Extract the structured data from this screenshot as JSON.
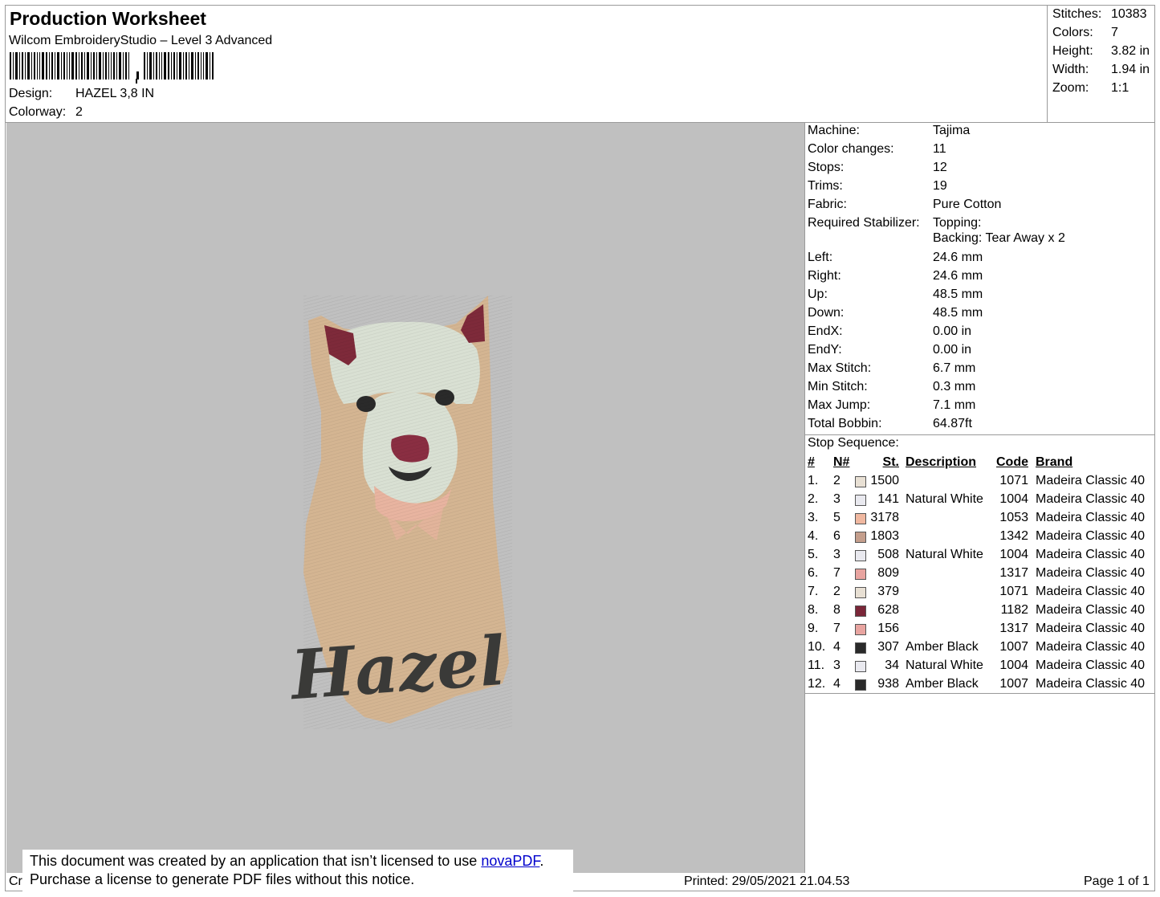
{
  "header": {
    "title": "Production Worksheet",
    "subtitle": "Wilcom EmbroideryStudio – Level 3 Advanced",
    "design_label": "Design:",
    "design_value": "HAZEL 3,8 IN",
    "colorway_label": "Colorway:",
    "colorway_value": "2"
  },
  "stats": [
    {
      "label": "Stitches:",
      "value": "10383"
    },
    {
      "label": "Colors:",
      "value": "7"
    },
    {
      "label": "Height:",
      "value": "3.82 in"
    },
    {
      "label": "Width:",
      "value": "1.94 in"
    },
    {
      "label": "Zoom:",
      "value": "1:1"
    }
  ],
  "design_preview": {
    "text": "Hazel",
    "background": "#c0c0c0",
    "fur_color": "#d4b592",
    "face_color": "#d9e0d3",
    "ear_color": "#7e2a3a",
    "nose_color": "#8a2e42",
    "chin_color": "#e8b4a0",
    "text_color": "#3a3a38"
  },
  "properties": [
    {
      "label": "Machine:",
      "value": "Tajima"
    },
    {
      "label": "Color changes:",
      "value": "11"
    },
    {
      "label": "Stops:",
      "value": "12"
    },
    {
      "label": "Trims:",
      "value": "19"
    },
    {
      "label": "Fabric:",
      "value": "Pure Cotton"
    },
    {
      "label": "Required Stabilizer:",
      "value": "Topping:",
      "value2": "Backing: Tear Away x 2"
    },
    {
      "label": "Left:",
      "value": "24.6 mm"
    },
    {
      "label": "Right:",
      "value": "24.6 mm"
    },
    {
      "label": "Up:",
      "value": "48.5 mm"
    },
    {
      "label": "Down:",
      "value": "48.5 mm"
    },
    {
      "label": "EndX:",
      "value": "0.00 in"
    },
    {
      "label": "EndY:",
      "value": "0.00 in"
    },
    {
      "label": "Max Stitch:",
      "value": "6.7 mm"
    },
    {
      "label": "Min Stitch:",
      "value": "0.3 mm"
    },
    {
      "label": "Max Jump:",
      "value": "7.1 mm"
    },
    {
      "label": "Total Bobbin:",
      "value": "64.87ft"
    }
  ],
  "stop_sequence": {
    "title": "Stop Sequence:",
    "headers": {
      "idx": "#",
      "needle": "N#",
      "stitches": "St.",
      "description": "Description",
      "code": "Code",
      "brand": "Brand"
    },
    "rows": [
      {
        "idx": "1.",
        "needle": "2",
        "color": "#e8e0d4",
        "stitches": "1500",
        "description": "",
        "code": "1071",
        "brand": "Madeira Classic 40"
      },
      {
        "idx": "2.",
        "needle": "3",
        "color": "#e9e9ef",
        "stitches": "141",
        "description": "Natural White",
        "code": "1004",
        "brand": "Madeira Classic 40"
      },
      {
        "idx": "3.",
        "needle": "5",
        "color": "#f0b8a0",
        "stitches": "3178",
        "description": "",
        "code": "1053",
        "brand": "Madeira Classic 40"
      },
      {
        "idx": "4.",
        "needle": "6",
        "color": "#c49e8c",
        "stitches": "1803",
        "description": "",
        "code": "1342",
        "brand": "Madeira Classic 40"
      },
      {
        "idx": "5.",
        "needle": "3",
        "color": "#e9e9ef",
        "stitches": "508",
        "description": "Natural White",
        "code": "1004",
        "brand": "Madeira Classic 40"
      },
      {
        "idx": "6.",
        "needle": "7",
        "color": "#e8a4a0",
        "stitches": "809",
        "description": "",
        "code": "1317",
        "brand": "Madeira Classic 40"
      },
      {
        "idx": "7.",
        "needle": "2",
        "color": "#e8e0d4",
        "stitches": "379",
        "description": "",
        "code": "1071",
        "brand": "Madeira Classic 40"
      },
      {
        "idx": "8.",
        "needle": "8",
        "color": "#7a2638",
        "stitches": "628",
        "description": "",
        "code": "1182",
        "brand": "Madeira Classic 40"
      },
      {
        "idx": "9.",
        "needle": "7",
        "color": "#e8a4a0",
        "stitches": "156",
        "description": "",
        "code": "1317",
        "brand": "Madeira Classic 40"
      },
      {
        "idx": "10.",
        "needle": "4",
        "color": "#2a2a2a",
        "stitches": "307",
        "description": "Amber Black",
        "code": "1007",
        "brand": "Madeira Classic 40"
      },
      {
        "idx": "11.",
        "needle": "3",
        "color": "#e9e9ef",
        "stitches": "34",
        "description": "Natural White",
        "code": "1004",
        "brand": "Madeira Classic 40"
      },
      {
        "idx": "12.",
        "needle": "4",
        "color": "#2a2a2a",
        "stitches": "938",
        "description": "Amber Black",
        "code": "1007",
        "brand": "Madeira Classic 40"
      }
    ]
  },
  "footer": {
    "left_fragment": "Cr",
    "printed": "Printed: 29/05/2021 21.04.53",
    "page": "Page 1 of 1"
  },
  "license_notice": {
    "line1_before": "This document was created by an application that isn’t licensed to use ",
    "link": "novaPDF",
    "line1_after": ".",
    "line2": "Purchase a license to generate PDF files without this notice."
  }
}
